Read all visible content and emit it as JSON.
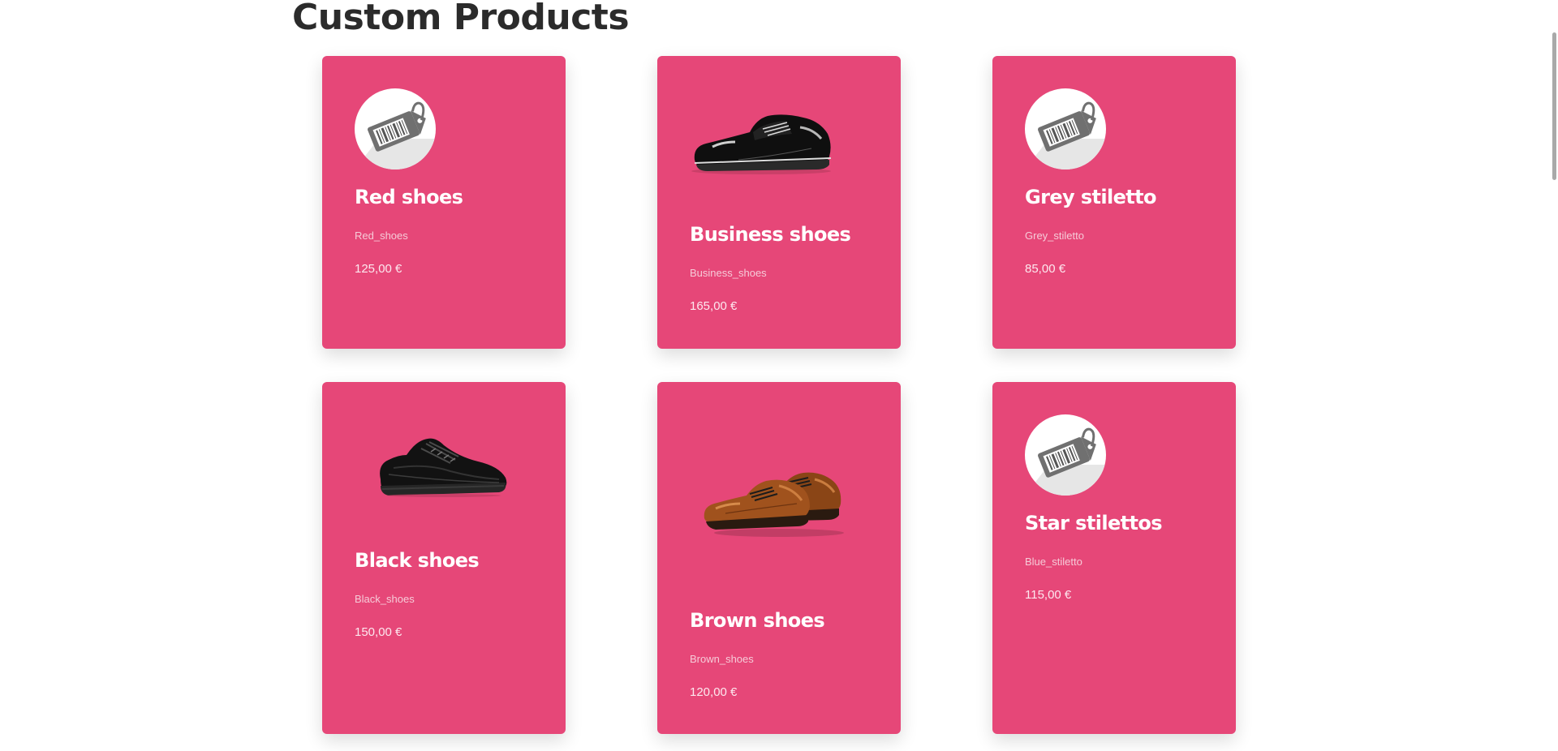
{
  "page": {
    "title": "Custom Products"
  },
  "products": [
    {
      "name": "Red shoes",
      "ref": "Red_shoes",
      "price": "125,00 €",
      "image": "price-tag-icon"
    },
    {
      "name": "Business shoes",
      "ref": "Business_shoes",
      "price": "165,00 €",
      "image": "black-dress-shoe"
    },
    {
      "name": "Grey stiletto",
      "ref": "Grey_stiletto",
      "price": "85,00 €",
      "image": "price-tag-icon"
    },
    {
      "name": "Black shoes",
      "ref": "Black_shoes",
      "price": "150,00 €",
      "image": "black-sneaker"
    },
    {
      "name": "Brown shoes",
      "ref": "Brown_shoes",
      "price": "120,00 €",
      "image": "brown-shoes-pair"
    },
    {
      "name": "Star stilettos",
      "ref": "Blue_stiletto",
      "price": "115,00 €",
      "image": "price-tag-icon"
    }
  ],
  "colors": {
    "card": "#e64778",
    "title": "#2b2b2b",
    "text": "#ffffff"
  }
}
